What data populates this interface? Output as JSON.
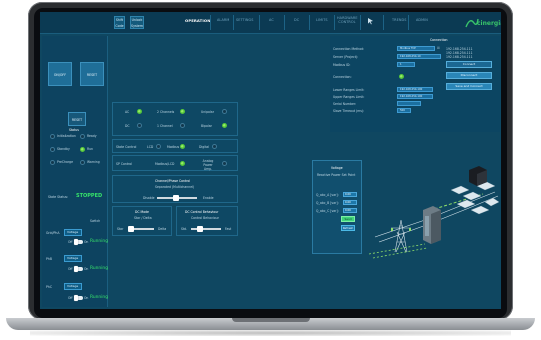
{
  "nav": {
    "quick_buttons": [
      "Shift Code",
      "Unlock System"
    ],
    "tabs": [
      "OPERATION",
      "ALARM",
      "SETTINGS",
      "AC",
      "DC",
      "LIMITS",
      "HARDWARE CONTROL",
      "",
      "TRENDS",
      "ADMIN"
    ],
    "active_tab": "OPERATION",
    "logo_text": "cinergia"
  },
  "left": {
    "top_buttons": [
      "ON/OFF",
      "RESET"
    ],
    "status_button": "RESET",
    "status_title": "Status",
    "states": [
      "Initialization",
      "Ready",
      "Standby",
      "Run",
      "PreCharge",
      "Warning"
    ],
    "state_run_active": true,
    "state_label": "State Status:",
    "state_value": "STOPPED",
    "setpoint_rows": [
      {
        "label": "Grid/PhA",
        "select": "Voltage",
        "off": "Off",
        "on": "On",
        "status": "Running",
        "header": "Switch"
      },
      {
        "label": "PhB",
        "select": "Voltage",
        "off": "Off",
        "on": "On",
        "status": "Running"
      },
      {
        "label": "PhC",
        "select": "Voltage",
        "off": "Off",
        "on": "On",
        "status": "Running"
      }
    ]
  },
  "center": {
    "row1": {
      "items": [
        "AC",
        "2 Channels",
        "Unipolar"
      ],
      "items2": [
        "DC",
        "1 Channel",
        "Bipolar"
      ]
    },
    "state_control": {
      "label": "State Control",
      "local": "LCD",
      "modbus": "Modbus",
      "digital": "Digital"
    },
    "sp_control": {
      "label": "SP Control",
      "modbus": "Modbus/LCD",
      "analog": "Analog Power Amp."
    },
    "channel_control": {
      "title": "Channel/Phase Control",
      "subtitle": "Separated (Multichannel)",
      "disable": "Disable",
      "enable": "Enable"
    },
    "dc_mode": {
      "title": "DC Mode",
      "subtitle": "Star / Delta",
      "left": "Star",
      "right": "Delta"
    },
    "dc_control": {
      "title": "DC Control Behaviour",
      "subtitle": "Control Behaviour",
      "left": "Std.",
      "right": "Fast"
    }
  },
  "connection": {
    "title": "Connection",
    "fields": [
      {
        "label": "Connection Method:",
        "value": "Modbus TCP"
      },
      {
        "label": "Server (Project):",
        "value": "192.168.254.10"
      },
      {
        "label": "Modbus ID:",
        "value": "1"
      },
      {
        "label": "Connection:",
        "value": ""
      },
      {
        "label": "Lower Ranges Limit:",
        "value": "192.168.254.100"
      },
      {
        "label": "Upper Ranges Limit:",
        "value": "192.168.254.100"
      },
      {
        "label": "Serial Number:",
        "value": ""
      },
      {
        "label": "Slave Timeout (ms):",
        "value": "500"
      }
    ],
    "ip_list": [
      "192.168.254.111",
      "192.168.254.111",
      "192.168.254.111"
    ],
    "buttons": [
      "Connect",
      "Disconnect",
      "Save and Connect"
    ]
  },
  "reactive": {
    "title": "Voltage",
    "subtitle": "Reactive Power Set Point",
    "rows": [
      {
        "label": "Q_abc_A [var]:",
        "value": "0.00"
      },
      {
        "label": "Q_abc_B [var]:",
        "value": "0.00"
      },
      {
        "label": "Q_abc_C [var]:",
        "value": "0.00"
      }
    ],
    "send": "Send",
    "refresh": "Refresh"
  },
  "colors": {
    "screen_bg": "#0f4761",
    "nav_bg": "#0b3a53",
    "accent": "#2a86b8",
    "running_green": "#36e36a",
    "logo_green": "#38c46a"
  }
}
